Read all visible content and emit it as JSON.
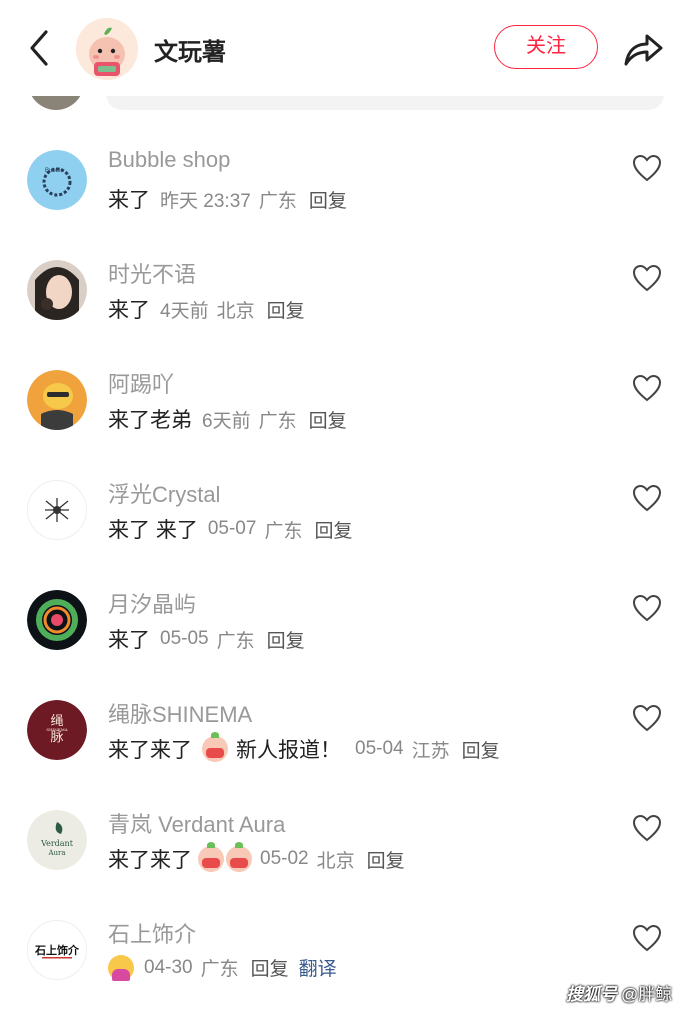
{
  "header": {
    "author_name": "文玩薯",
    "follow_label": "关注"
  },
  "comments": [
    {
      "name": "Bubble shop",
      "text": "来了",
      "time": "昨天 23:37",
      "location": "广东",
      "reply": "回复"
    },
    {
      "name": "时光不语",
      "text": "来了",
      "time": "4天前",
      "location": "北京",
      "reply": "回复"
    },
    {
      "name": "阿踢吖",
      "text": "来了老弟",
      "time": "6天前",
      "location": "广东",
      "reply": "回复"
    },
    {
      "name": "浮光Crystal",
      "text": "来了 来了",
      "time": "05-07",
      "location": "广东",
      "reply": "回复"
    },
    {
      "name": "月汐晶屿",
      "text": "来了",
      "time": "05-05",
      "location": "广东",
      "reply": "回复"
    },
    {
      "name": "绳脉SHINEMA",
      "text": "来了来了",
      "text_after": "新人报道！",
      "time": "05-04",
      "location": "江苏",
      "reply": "回复",
      "avatar_text": [
        "绳",
        "脉",
        "SHINEMA"
      ]
    },
    {
      "name": "青岚 Verdant Aura",
      "text": "来了来了",
      "time": "05-02",
      "location": "北京",
      "reply": "回复",
      "avatar_text": [
        "Verdant",
        "Aura"
      ]
    },
    {
      "name": "石上饰介",
      "text": "",
      "time": "04-30",
      "location": "广东",
      "reply": "回复",
      "translate": "翻译",
      "avatar_text": [
        "石上饰介"
      ]
    }
  ],
  "watermark": {
    "brand": "搜狐号",
    "handle": "@胖鲸"
  },
  "colors": {
    "accent": "#ff2442",
    "name_gray": "#999999",
    "meta_gray": "#888888",
    "translate_blue": "#3a5a8c"
  }
}
